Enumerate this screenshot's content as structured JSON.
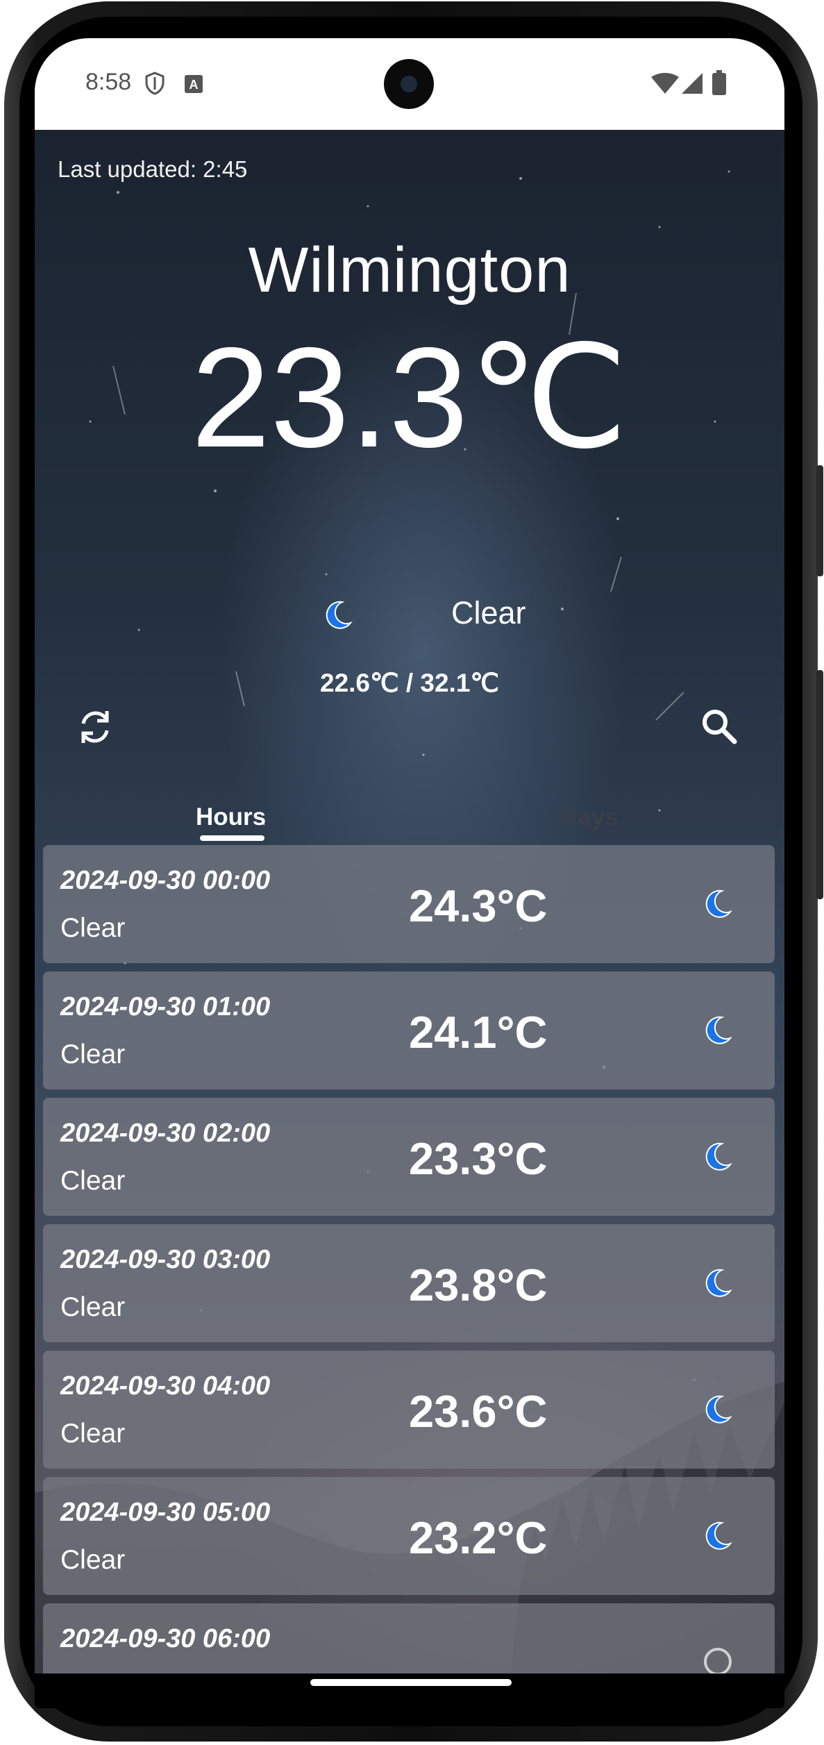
{
  "status_bar": {
    "time": "8:58",
    "icons": [
      "shield-icon",
      "font-a-icon",
      "wifi-icon",
      "cellular-icon",
      "battery-icon"
    ]
  },
  "weather": {
    "last_updated": "Last updated: 2:45",
    "city": "Wilmington",
    "current_temp": "23.3℃",
    "condition": "Clear",
    "condition_icon": "crescent-moon-icon",
    "min_max": "22.6℃ / 32.1℃"
  },
  "actions": {
    "refresh_icon": "refresh-icon",
    "search_icon": "search-icon"
  },
  "tabs": [
    {
      "label": "Hours",
      "selected": true
    },
    {
      "label": "Days",
      "selected": false
    }
  ],
  "hours": [
    {
      "datetime": "2024-09-30 00:00",
      "condition": "Clear",
      "temp": "24.3°C",
      "icon": "crescent-moon-icon"
    },
    {
      "datetime": "2024-09-30 01:00",
      "condition": "Clear",
      "temp": "24.1°C",
      "icon": "crescent-moon-icon"
    },
    {
      "datetime": "2024-09-30 02:00",
      "condition": "Clear",
      "temp": "23.3°C",
      "icon": "crescent-moon-icon"
    },
    {
      "datetime": "2024-09-30 03:00",
      "condition": "Clear",
      "temp": "23.8°C",
      "icon": "crescent-moon-icon"
    },
    {
      "datetime": "2024-09-30 04:00",
      "condition": "Clear",
      "temp": "23.6°C",
      "icon": "crescent-moon-icon"
    },
    {
      "datetime": "2024-09-30 05:00",
      "condition": "Clear",
      "temp": "23.2°C",
      "icon": "crescent-moon-icon"
    },
    {
      "datetime": "2024-09-30 06:00",
      "condition": "",
      "temp": "",
      "icon": "partly-visible-icon"
    }
  ],
  "colors": {
    "accent_moon": "#1a73e8",
    "card_bg": "#787c84",
    "tab_inactive": "#3a3f49"
  }
}
